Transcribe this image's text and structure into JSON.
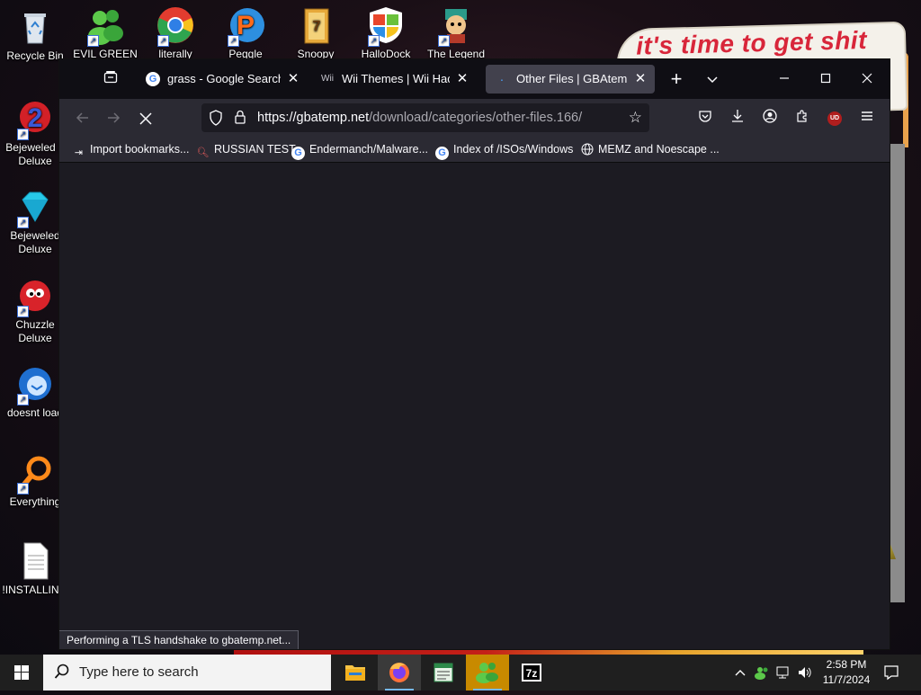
{
  "desktop": {
    "wallpaper_text": "it's time to get shit",
    "icons": [
      {
        "label": "Recycle Bin"
      },
      {
        "label": "Bejeweled 2 Deluxe"
      },
      {
        "label": "Bejeweled Deluxe"
      },
      {
        "label": "Chuzzle Deluxe"
      },
      {
        "label": "doesnt load"
      },
      {
        "label": "Everything"
      },
      {
        "label": "!INSTALLIN..."
      },
      {
        "label": "EVIL GREEN"
      },
      {
        "label": "literally"
      },
      {
        "label": "Peggle Nights"
      },
      {
        "label": "Snoopy"
      },
      {
        "label": "HalloDock"
      },
      {
        "label": "The Legend"
      }
    ]
  },
  "browser": {
    "tabs": [
      {
        "title": "grass - Google Search",
        "favicon": "google-icon"
      },
      {
        "title": "Wii Themes | Wii Hacks Gui",
        "favicon": "wii-icon"
      },
      {
        "title": "Other Files | GBAtemp.net",
        "favicon": "loading-icon"
      }
    ],
    "active_tab": 2,
    "url_host": "https://gbatemp.net",
    "url_path": "/download/categories/other-files.166/",
    "bookmarks": [
      {
        "label": "Import bookmarks...",
        "icon": "import-icon"
      },
      {
        "label": "RUSSIAN TEST",
        "icon": "search-icon"
      },
      {
        "label": "Endermanch/Malware...",
        "icon": "google-icon"
      },
      {
        "label": "Index of /ISOs/Windows",
        "icon": "google-icon"
      },
      {
        "label": "MEMZ and Noescape ...",
        "icon": "globe-icon"
      }
    ],
    "status": "Performing a TLS handshake to gbatemp.net...",
    "ublock_badge": "UD"
  },
  "taskbar": {
    "search_placeholder": "Type here to search",
    "apps": [
      "file-explorer",
      "firefox",
      "notepad",
      "evil-green",
      "7zip"
    ],
    "time": "2:58 PM",
    "date": "11/7/2024",
    "accent": "#76b9ed"
  }
}
